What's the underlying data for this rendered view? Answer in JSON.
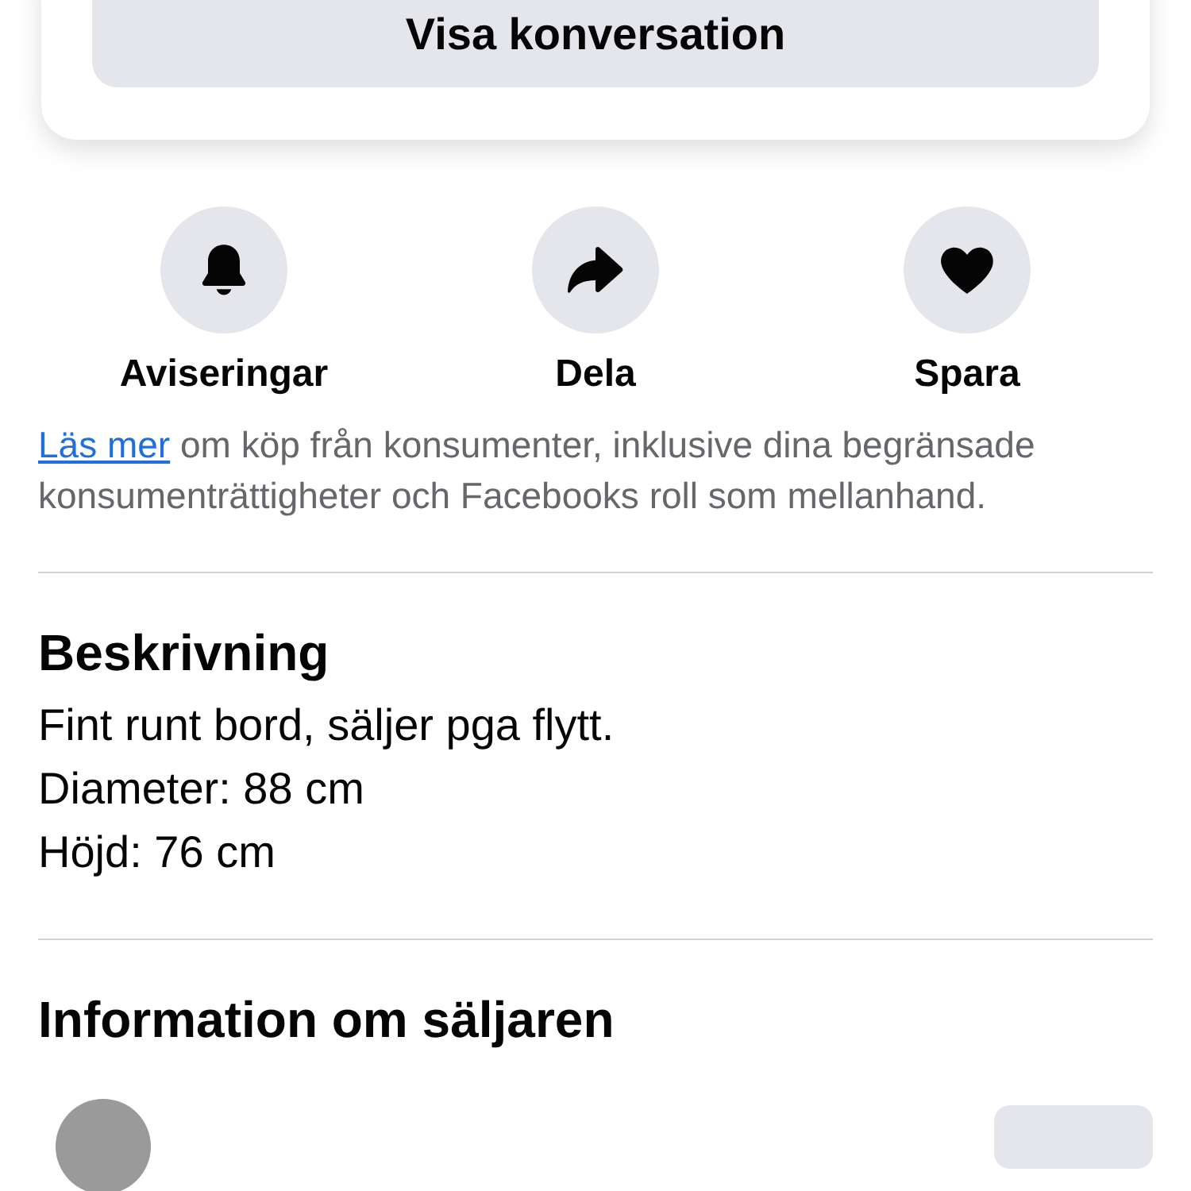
{
  "conversation_card": {
    "button": "Visa konversation"
  },
  "actions": [
    {
      "kind": "bell",
      "label": "Aviseringar"
    },
    {
      "kind": "share",
      "label": "Dela"
    },
    {
      "kind": "heart",
      "label": "Spara"
    }
  ],
  "notice": {
    "link": "Läs mer",
    "text": "om köp från konsumenter, inklusive dina begränsade konsumenträttigheter och Facebooks roll som mellanhand."
  },
  "description": {
    "heading": "Beskrivning",
    "lines": [
      "Fint runt bord, säljer pga flytt.",
      "Diameter: 88 cm",
      "Höjd: 76 cm"
    ]
  },
  "seller": {
    "heading": "Information om säljaren"
  }
}
